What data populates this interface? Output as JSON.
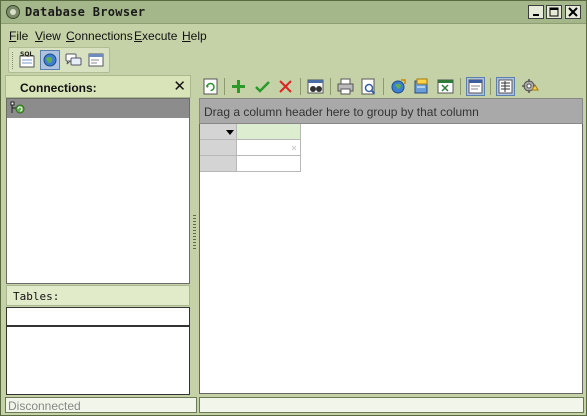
{
  "window": {
    "title": "Database Browser"
  },
  "menu": [
    {
      "label": "File",
      "key": "F",
      "rest": "ile"
    },
    {
      "label": "View",
      "key": "V",
      "rest": "iew"
    },
    {
      "label": "Connections",
      "key": "C",
      "rest": "onnections"
    },
    {
      "label": "Execute",
      "key": "E",
      "rest": "xecute"
    },
    {
      "label": "Help",
      "key": "H",
      "rest": "elp"
    }
  ],
  "main_toolbar": {
    "sql_icon_text": "SQL"
  },
  "connections_panel": {
    "title": "Connections:",
    "close_glyph": "✕"
  },
  "tables_panel": {
    "label": "Tables:"
  },
  "grid": {
    "group_hint": "Drag a column header here to group by that column"
  },
  "status": {
    "left": "Disconnected"
  },
  "colors": {
    "window_bg": "#c5d2a8",
    "titlebar": "#a4b78a",
    "group_panel": "#a9a9a9",
    "header_green": "#d9e5b9"
  }
}
